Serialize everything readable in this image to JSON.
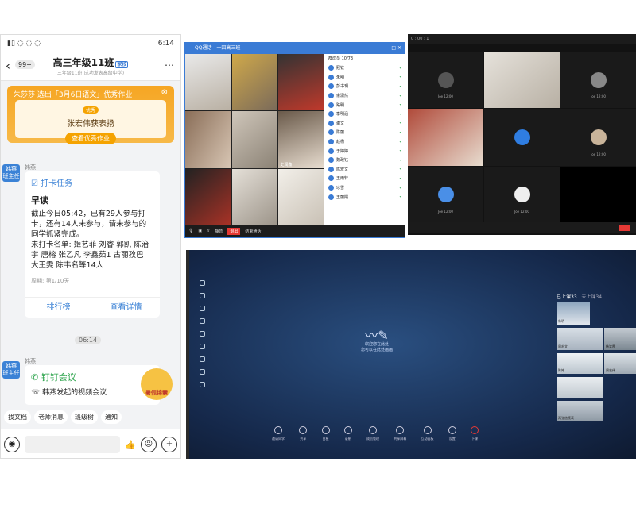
{
  "phone": {
    "status_time": "6:14",
    "back_count": "99+",
    "chat_title": "高三年级11班",
    "chat_tag": "家校",
    "chat_subtitle": "三年级11班(成功发表高级中学)",
    "banner_title": "朱莎莎 选出「3月6日语文」优秀作业",
    "banner_medal": "优秀",
    "banner_name": "张宏伟获表扬",
    "banner_button": "查看优秀作业",
    "sender": "韩燕",
    "avatar_text": "韩燕\n班主任",
    "checkin": {
      "label": "打卡任务",
      "title": "早读",
      "text": "截止今日05:42，已有29人参与打卡，还有14人未参与，请未参与的同学抓紧完成。\n未打卡名单: 姬艺菲 刘睿 郭凯 陈治宇 唐榕 张乙凡 李鑫茹1 古丽孜巴 大王雯 陈韦名等14人",
      "period": "周期: 第1/10天",
      "btn_rank": "排行榜",
      "btn_detail": "查看详情"
    },
    "time_chip": "06:14",
    "meeting": {
      "title": "钉钉会议",
      "text": "韩燕发起的视频会议",
      "deco": "暑假锦囊"
    },
    "quick": [
      "找文档",
      "老师消息",
      "班级树",
      "通知"
    ]
  },
  "qq": {
    "title": "QQ通话 - 十四高三班",
    "list_header": "群成员 10/73",
    "members": [
      "冠钦",
      "朱明",
      "彭书玥",
      "余潇然",
      "路明",
      "季明涵",
      "谢文",
      "陈丽",
      "赵杨",
      "于婷婷",
      "魏政钰",
      "陈宏文",
      "王雨轩",
      "冰雪",
      "王丽娟"
    ],
    "tiles": [
      "",
      "",
      "",
      "",
      "",
      "史润鑫",
      "",
      "",
      ""
    ],
    "foot_mute": "静音",
    "foot_exit": "退出",
    "foot_end": "结束通话"
  },
  "dark": {
    "title": "0 : 00 : 1",
    "labels": [
      "Joe 12:00",
      "",
      "Joe 12:00",
      "",
      "",
      "Joe 12:00",
      "Joe 12:00",
      "Joe 12:00",
      ""
    ]
  },
  "board": {
    "hint_line1": "欢迎您在此处",
    "hint_line2": "您可以在此处画画",
    "panel_online": "已上课33",
    "panel_offline": "未上课34",
    "thumb_labels": [
      "朱明",
      "周宏文",
      "韩笑霞",
      "陈婷",
      "周宏伟",
      "",
      "两张信笺表"
    ],
    "tools": [
      "邀请同学",
      "共享",
      "白板",
      "录制",
      "成员管理",
      "共享屏幕",
      "互动面板",
      "设置",
      "下课"
    ]
  }
}
